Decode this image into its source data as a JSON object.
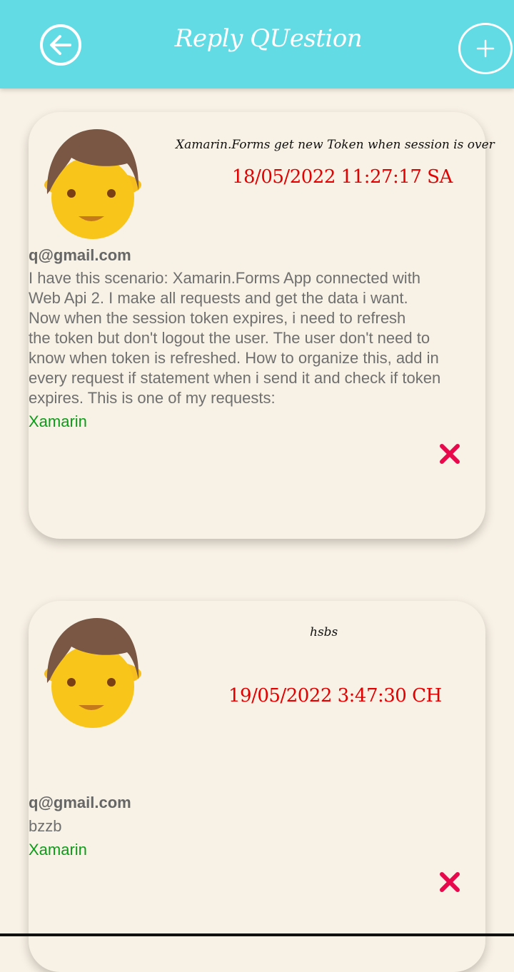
{
  "header": {
    "title": "Reply QUestion",
    "back_icon": "arrow-left-circle-icon",
    "add_icon": "plus-circle-icon",
    "background": "#62dbe5"
  },
  "questions": [
    {
      "avatar_icon": "boy-avatar-icon",
      "title": "Xamarin.Forms get new Token when session is over",
      "date": "18/05/2022 11:27:17 SA",
      "email": "q@gmail.com",
      "content": "I have this scenario: Xamarin.Forms App connected with\nWeb Api 2. I make all requests and get the data i want.\nNow when the session token expires, i need to refresh\nthe token but don't logout the user. The user don't need to\nknow when token is refreshed. How to organize this, add in\nevery request if statement when i send it and check if token\nexpires. This is one of my requests:",
      "tag": "Xamarin",
      "delete_icon": "close-x-icon"
    },
    {
      "avatar_icon": "boy-avatar-icon",
      "title": "hsbs",
      "date": "19/05/2022 3:47:30 CH",
      "email": "q@gmail.com",
      "content": "bzzb",
      "tag": "Xamarin",
      "delete_icon": "close-x-icon"
    }
  ],
  "colors": {
    "date": "#e30000",
    "tag": "#0e9b1a",
    "delete": "#e8094d",
    "page_background": "#f8f1e5"
  }
}
